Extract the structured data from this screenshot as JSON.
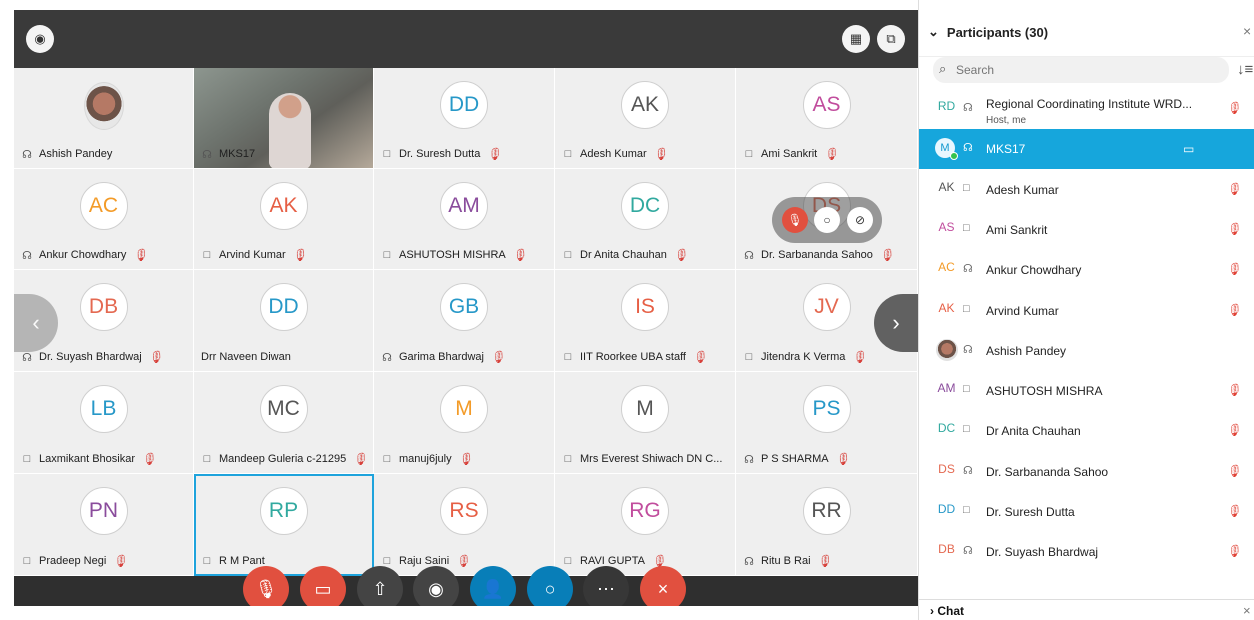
{
  "top_controls": {
    "left_icon": "◉",
    "grid_icon": "▦",
    "popout_icon": "⧉"
  },
  "tiles": [
    {
      "initials": "",
      "name": "Ashish Pandey",
      "icon": "☊",
      "muted": false,
      "color": "#333333",
      "image": "photo"
    },
    {
      "initials": "",
      "name": "MKS17",
      "icon": "☊",
      "muted": false,
      "color": "#333333",
      "image": "video"
    },
    {
      "initials": "DD",
      "name": "Dr. Suresh Dutta",
      "icon": "□",
      "muted": true,
      "color": "#2798c8",
      "image": ""
    },
    {
      "initials": "AK",
      "name": "Adesh Kumar",
      "icon": "□",
      "muted": true,
      "color": "#555555",
      "image": ""
    },
    {
      "initials": "AS",
      "name": "Ami Sankrit",
      "icon": "□",
      "muted": true,
      "color": "#c14d9d",
      "image": ""
    },
    {
      "initials": "AC",
      "name": "Ankur Chowdhary",
      "icon": "☊",
      "muted": true,
      "color": "#f39b28",
      "image": ""
    },
    {
      "initials": "AK",
      "name": "Arvind Kumar",
      "icon": "□",
      "muted": true,
      "color": "#e65f45",
      "image": ""
    },
    {
      "initials": "AM",
      "name": "ASHUTOSH MISHRA",
      "icon": "□",
      "muted": true,
      "color": "#8a4c9c",
      "image": ""
    },
    {
      "initials": "DC",
      "name": "Dr Anita Chauhan",
      "icon": "□",
      "muted": true,
      "color": "#31a99f",
      "image": ""
    },
    {
      "initials": "DS",
      "name": "Dr. Sarbananda Sahoo",
      "icon": "☊",
      "muted": true,
      "color": "#e46951",
      "image": ""
    },
    {
      "initials": "DB",
      "name": "Dr. Suyash Bhardwaj",
      "icon": "☊",
      "muted": true,
      "color": "#e46951",
      "image": ""
    },
    {
      "initials": "DD",
      "name": "Drr Naveen Diwan",
      "icon": "",
      "muted": false,
      "color": "#2798c8",
      "image": ""
    },
    {
      "initials": "GB",
      "name": "Garima Bhardwaj",
      "icon": "☊",
      "muted": true,
      "color": "#2798c8",
      "image": ""
    },
    {
      "initials": "IS",
      "name": "IIT Roorkee UBA staff",
      "icon": "□",
      "muted": true,
      "color": "#e65f45",
      "image": ""
    },
    {
      "initials": "JV",
      "name": "Jitendra K Verma",
      "icon": "□",
      "muted": true,
      "color": "#e46951",
      "image": ""
    },
    {
      "initials": "LB",
      "name": "Laxmikant Bhosikar",
      "icon": "□",
      "muted": true,
      "color": "#2798c8",
      "image": ""
    },
    {
      "initials": "MC",
      "name": "Mandeep Guleria c-21295",
      "icon": "□",
      "muted": true,
      "color": "#555555",
      "image": ""
    },
    {
      "initials": "M",
      "name": "manuj6july",
      "icon": "□",
      "muted": true,
      "color": "#f39b28",
      "image": ""
    },
    {
      "initials": "M",
      "name": "Mrs Everest Shiwach DN C...",
      "icon": "□",
      "muted": true,
      "color": "#555555",
      "image": ""
    },
    {
      "initials": "PS",
      "name": "P S SHARMA",
      "icon": "☊",
      "muted": true,
      "color": "#2798c8",
      "image": ""
    },
    {
      "initials": "PN",
      "name": "Pradeep Negi",
      "icon": "□",
      "muted": true,
      "color": "#8a4c9c",
      "image": ""
    },
    {
      "initials": "RP",
      "name": "R M Pant",
      "icon": "□",
      "muted": false,
      "color": "#31a99f",
      "image": ""
    },
    {
      "initials": "RS",
      "name": "Raju Saini",
      "icon": "□",
      "muted": true,
      "color": "#e65f45",
      "image": ""
    },
    {
      "initials": "RG",
      "name": "RAVI GUPTA",
      "icon": "□",
      "muted": true,
      "color": "#c14d9d",
      "image": ""
    },
    {
      "initials": "RR",
      "name": "Ritu B Rai",
      "icon": "☊",
      "muted": true,
      "color": "#555555",
      "image": ""
    }
  ],
  "controls": {
    "mute": "🎙",
    "video": "▭",
    "share": "⇧",
    "record": "◉",
    "participants": "👤",
    "chat": "○",
    "more": "⋯",
    "end": "×"
  },
  "sidebar": {
    "title": "Participants (30)",
    "search_placeholder": "Search",
    "chat_label": "Chat",
    "rows": [
      {
        "initials": "RD",
        "name": "Regional Coordinating Institute WRD...",
        "sub": "Host, me",
        "icon": "☊",
        "muted": true,
        "color": "#31a99f",
        "type": "normal"
      },
      {
        "initials": "M",
        "name": "MKS17",
        "sub": "",
        "icon": "☊",
        "muted": false,
        "color": "#1399cf",
        "type": "active"
      },
      {
        "initials": "AK",
        "name": "Adesh Kumar",
        "sub": "",
        "icon": "□",
        "muted": true,
        "color": "#555555",
        "type": "normal"
      },
      {
        "initials": "AS",
        "name": "Ami Sankrit",
        "sub": "",
        "icon": "□",
        "muted": true,
        "color": "#c14d9d",
        "type": "normal"
      },
      {
        "initials": "AC",
        "name": "Ankur Chowdhary",
        "sub": "",
        "icon": "☊",
        "muted": true,
        "color": "#f39b28",
        "type": "normal"
      },
      {
        "initials": "AK",
        "name": "Arvind Kumar",
        "sub": "",
        "icon": "□",
        "muted": true,
        "color": "#e65f45",
        "type": "normal"
      },
      {
        "initials": "",
        "name": "Ashish Pandey",
        "sub": "",
        "icon": "☊",
        "muted": false,
        "color": "#333333",
        "type": "photo"
      },
      {
        "initials": "AM",
        "name": "ASHUTOSH MISHRA",
        "sub": "",
        "icon": "□",
        "muted": true,
        "color": "#8a4c9c",
        "type": "normal"
      },
      {
        "initials": "DC",
        "name": "Dr Anita Chauhan",
        "sub": "",
        "icon": "□",
        "muted": true,
        "color": "#31a99f",
        "type": "normal"
      },
      {
        "initials": "DS",
        "name": "Dr. Sarbananda Sahoo",
        "sub": "",
        "icon": "☊",
        "muted": true,
        "color": "#e46951",
        "type": "normal"
      },
      {
        "initials": "DD",
        "name": "Dr. Suresh Dutta",
        "sub": "",
        "icon": "□",
        "muted": true,
        "color": "#2798c8",
        "type": "normal"
      },
      {
        "initials": "DB",
        "name": "Dr. Suyash Bhardwaj",
        "sub": "",
        "icon": "☊",
        "muted": true,
        "color": "#e46951",
        "type": "normal"
      }
    ]
  }
}
